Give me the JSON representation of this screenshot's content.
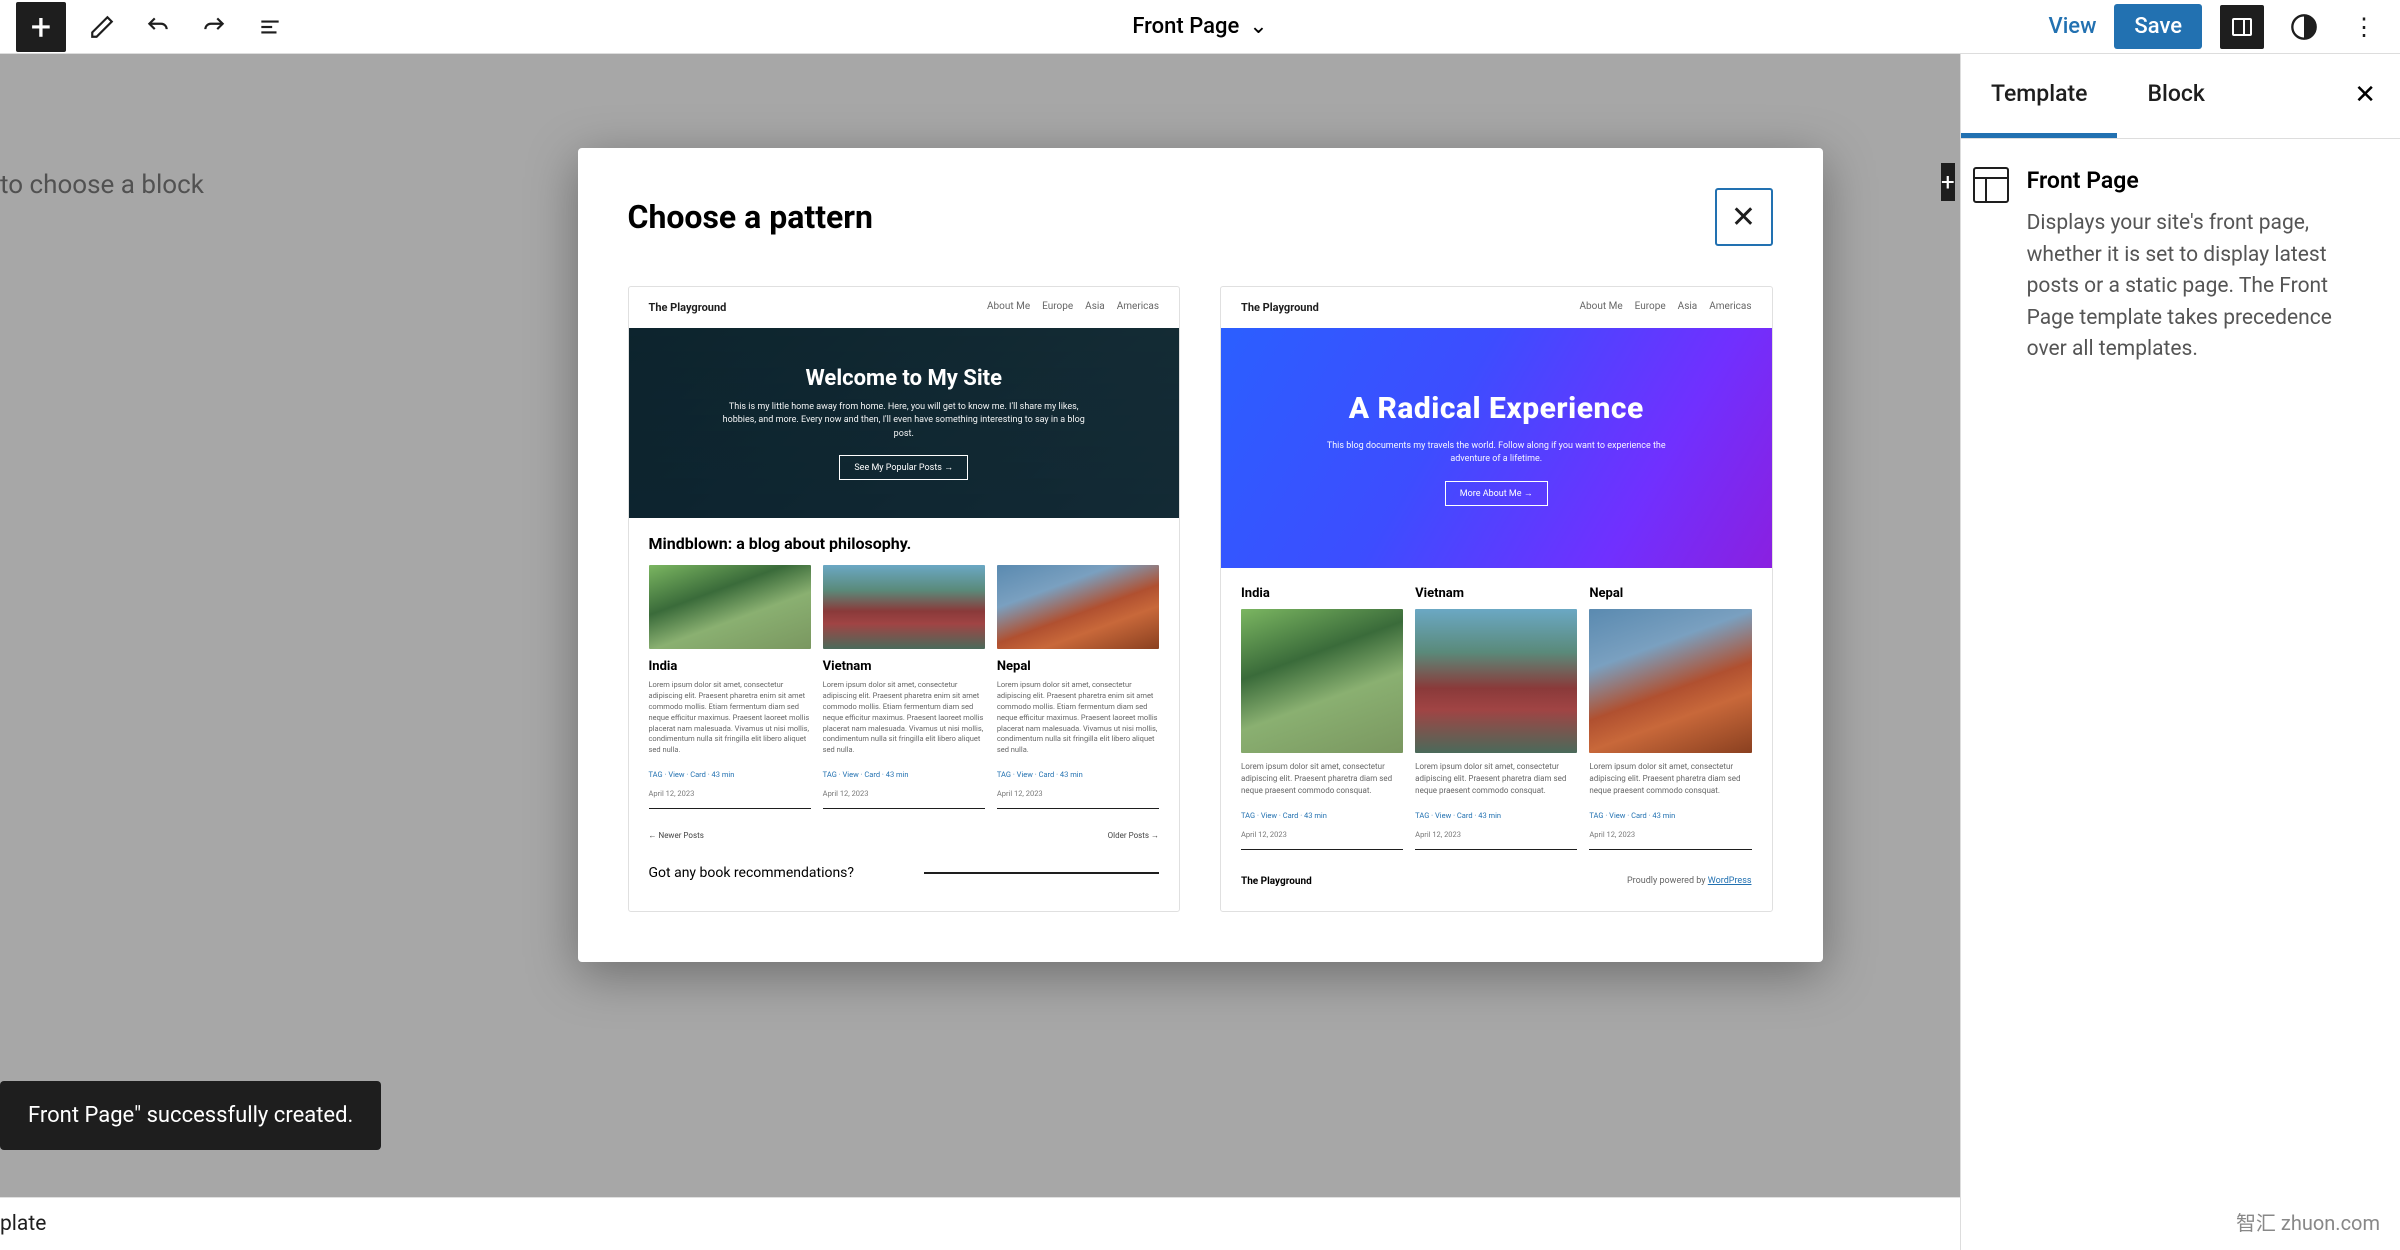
{
  "toolbar": {
    "document_title": "Front Page",
    "view_label": "View",
    "save_label": "Save"
  },
  "canvas": {
    "placeholder": "to choose a block"
  },
  "sidebar": {
    "tabs": {
      "template": "Template",
      "block": "Block"
    },
    "template_name": "Front Page",
    "template_description": "Displays your site's front page, whether it is set to display latest posts or a static page. The Front Page template takes precedence over all templates."
  },
  "snackbar": {
    "message": "Front Page\" successfully created."
  },
  "footer": {
    "breadcrumb": "plate"
  },
  "modal": {
    "title": "Choose a pattern",
    "pattern1": {
      "brand": "The Playground",
      "nav": [
        "About Me",
        "Europe",
        "Asia",
        "Americas"
      ],
      "hero_title": "Welcome to My Site",
      "hero_sub": "This is my little home away from home. Here, you will get to know me. I'll share my likes, hobbies, and more. Every now and then, I'll even have something interesting to say in a blog post.",
      "hero_button": "See My Popular Posts →",
      "section_title": "Mindblown: a blog about philosophy.",
      "posts": [
        {
          "title": "India",
          "date": "April 12, 2023"
        },
        {
          "title": "Vietnam",
          "date": "April 12, 2023"
        },
        {
          "title": "Nepal",
          "date": "April 12, 2023"
        }
      ],
      "post_body": "Lorem ipsum dolor sit amet, consectetur adipiscing elit. Praesent pharetra enim sit amet commodo mollis. Etiam fermentum diam sed neque efficitur maximus. Praesent laoreet mollis placerat nam malesuada. Vivamus ut nisi mollis, condimentum nulla sit fringilla elit libero aliquet sed nulla.",
      "tags": "TAG · View · Card · 43 min",
      "nav_prev": "← Newer Posts",
      "nav_next": "Older Posts →",
      "cta": "Got any book recommendations?"
    },
    "pattern2": {
      "brand": "The Playground",
      "nav": [
        "About Me",
        "Europe",
        "Asia",
        "Americas"
      ],
      "hero_title": "A Radical  Experience",
      "hero_sub": "This blog documents my travels the world. Follow along if you want to experience the adventure of a lifetime.",
      "hero_button": "More About Me →",
      "posts": [
        {
          "title": "India",
          "date": "April 12, 2023"
        },
        {
          "title": "Vietnam",
          "date": "April 12, 2023"
        },
        {
          "title": "Nepal",
          "date": "April 12, 2023"
        }
      ],
      "post_body": "Lorem ipsum dolor sit amet, consectetur adipiscing elit. Praesent pharetra diam sed neque praesent commodo consquat.",
      "tags": "TAG · View · Card · 43 min",
      "footer_brand": "The Playground",
      "footer_credit_prefix": "Proudly powered by ",
      "footer_credit_link": "WordPress"
    }
  },
  "watermark": "智汇 zhuon.com"
}
